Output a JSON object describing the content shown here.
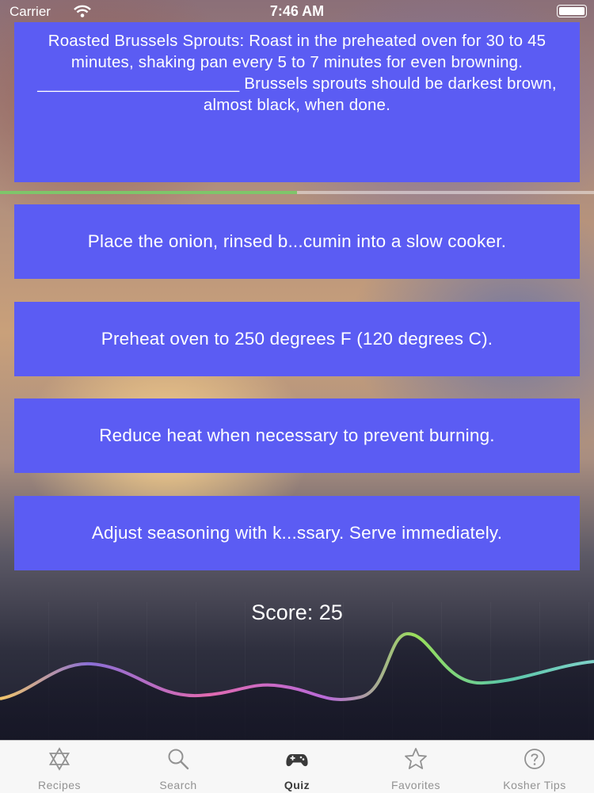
{
  "status_bar": {
    "carrier": "Carrier",
    "time": "7:46 AM"
  },
  "quiz": {
    "question": "Roasted Brussels Sprouts: Roast in the preheated oven for 30 to 45 minutes, shaking pan every 5 to 7 minutes for even browning. ______________________ Brussels sprouts should be darkest brown, almost black, when done.",
    "progress": 0.5,
    "answers": [
      "Place the onion, rinsed b...cumin into a slow cooker.",
      "Preheat oven to 250 degrees F (120 degrees C).",
      "Reduce heat when necessary to prevent burning.",
      "Adjust seasoning with k...ssary. Serve immediately."
    ],
    "score": "Score: 25"
  },
  "tab_bar": {
    "items": [
      {
        "label": "Recipes",
        "icon": "star-of-david-icon"
      },
      {
        "label": "Search",
        "icon": "search-icon"
      },
      {
        "label": "Quiz",
        "icon": "gamepad-icon",
        "active": true
      },
      {
        "label": "Favorites",
        "icon": "star-icon"
      },
      {
        "label": "Kosher Tips",
        "icon": "question-circle-icon"
      }
    ]
  },
  "colors": {
    "card": "#5b5cf3",
    "progress_fill": "#7fc56a",
    "tab_inactive": "#929292",
    "tab_active": "#3a3a3a"
  }
}
